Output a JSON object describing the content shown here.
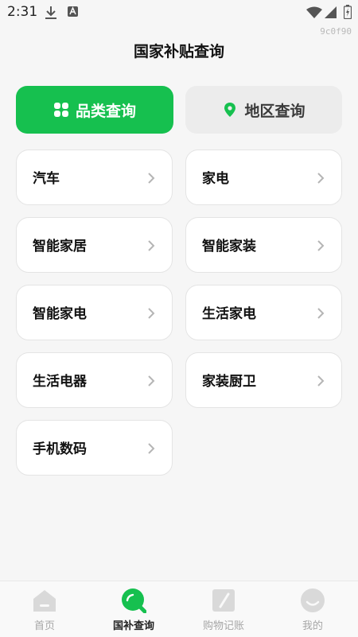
{
  "status_bar": {
    "time": "2:31"
  },
  "watermark": "9c0f90",
  "header": {
    "title": "国家补贴查询"
  },
  "tabs": [
    {
      "label": "品类查询",
      "icon": "grid-icon",
      "active": true
    },
    {
      "label": "地区查询",
      "icon": "location-pin-icon",
      "active": false
    }
  ],
  "categories": [
    {
      "label": "汽车"
    },
    {
      "label": "家电"
    },
    {
      "label": "智能家居"
    },
    {
      "label": "智能家装"
    },
    {
      "label": "智能家电"
    },
    {
      "label": "生活家电"
    },
    {
      "label": "生活电器"
    },
    {
      "label": "家装厨卫"
    },
    {
      "label": "手机数码"
    }
  ],
  "bottom_nav": [
    {
      "label": "首页",
      "icon": "home-icon",
      "active": false
    },
    {
      "label": "国补查询",
      "icon": "search-icon",
      "active": true
    },
    {
      "label": "购物记账",
      "icon": "note-pencil-icon",
      "active": false
    },
    {
      "label": "我的",
      "icon": "smiley-icon",
      "active": false
    }
  ],
  "colors": {
    "accent": "#16c04f",
    "background": "#f6f6f6",
    "inactive": "#a6a6a6"
  }
}
